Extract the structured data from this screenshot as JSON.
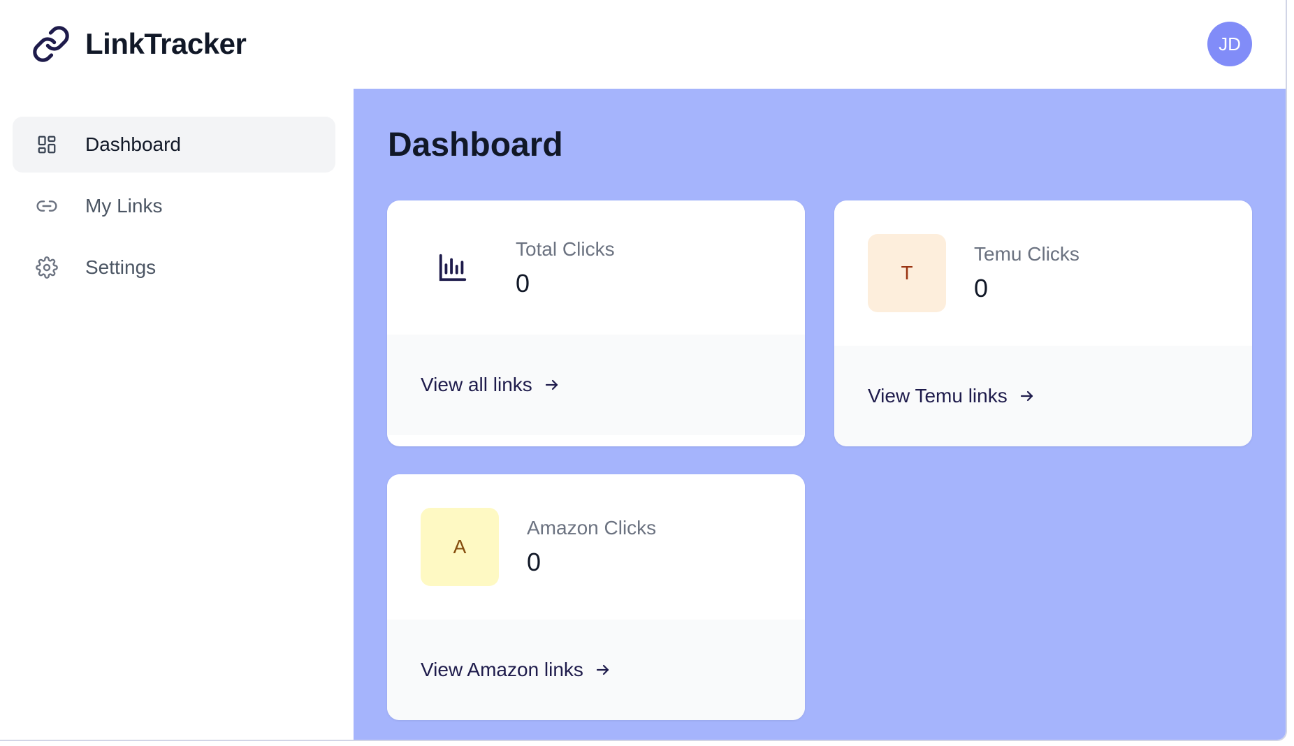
{
  "app": {
    "name": "LinkTracker",
    "user_initials": "JD"
  },
  "sidebar": {
    "items": [
      {
        "label": "Dashboard",
        "icon": "dashboard-grid-icon",
        "active": true
      },
      {
        "label": "My Links",
        "icon": "link-icon",
        "active": false
      },
      {
        "label": "Settings",
        "icon": "gear-icon",
        "active": false
      }
    ]
  },
  "main": {
    "title": "Dashboard",
    "cards": [
      {
        "label": "Total Clicks",
        "value": "0",
        "link": "View all links",
        "icon": "bar-chart-icon"
      },
      {
        "label": "Temu Clicks",
        "value": "0",
        "link": "View Temu links",
        "badge": "T",
        "badge_bg": "#fdeedc",
        "badge_color": "#9a3412"
      },
      {
        "label": "Amazon Clicks",
        "value": "0",
        "link": "View Amazon links",
        "badge": "A",
        "badge_bg": "#fef9c3",
        "badge_color": "#854d0e"
      }
    ]
  },
  "colors": {
    "main_bg": "#a5b4fc",
    "avatar_bg": "#818cf8",
    "accent_text": "#1e1b4b"
  }
}
